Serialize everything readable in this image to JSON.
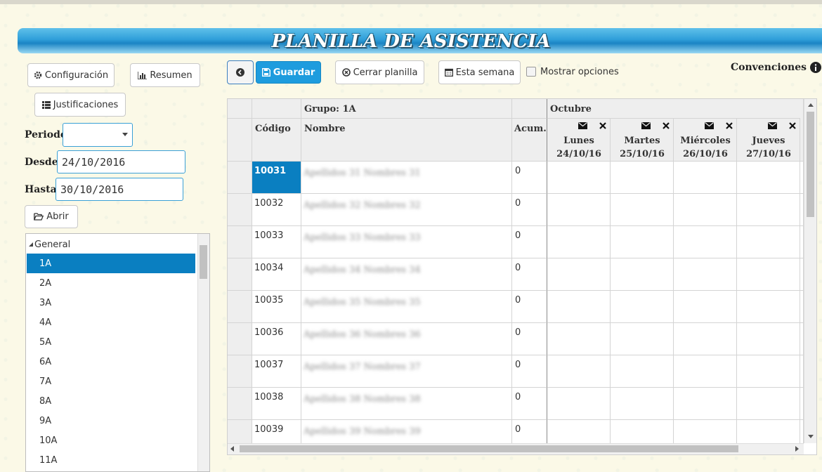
{
  "page": {
    "title": "PLANILLA DE ASISTENCIA"
  },
  "sidebar": {
    "config_label": "Configuración",
    "summary_label": "Resumen",
    "justifications_label": "Justificaciones",
    "period_label": "Periodo",
    "period_value": "",
    "from_label": "Desde",
    "from_value": "24/10/2016",
    "to_label": "Hasta",
    "to_value": "30/10/2016",
    "open_label": "Abrir",
    "tree": {
      "root": "General",
      "items": [
        "1A",
        "2A",
        "3A",
        "4A",
        "5A",
        "6A",
        "7A",
        "8A",
        "9A",
        "10A",
        "11A"
      ],
      "selected": "1A"
    }
  },
  "toolbar": {
    "save_label": "Guardar",
    "close_label": "Cerrar planilla",
    "week_label": "Esta semana",
    "options_label": "Mostrar opciones",
    "conventions_label": "Convenciones"
  },
  "grid": {
    "group_header": "Grupo: 1A",
    "month_header": "Octubre",
    "columns": {
      "code": "Código",
      "name": "Nombre",
      "acum": "Acum."
    },
    "days": [
      {
        "name": "Lunes",
        "date": "24/10/16"
      },
      {
        "name": "Martes",
        "date": "25/10/16"
      },
      {
        "name": "Miércoles",
        "date": "26/10/16"
      },
      {
        "name": "Jueves",
        "date": "27/10/16"
      }
    ],
    "rows": [
      {
        "code": "10031",
        "name": "Apellidos 31 Nombres 31",
        "acum": "0"
      },
      {
        "code": "10032",
        "name": "Apellidos 32 Nombres 32",
        "acum": "0"
      },
      {
        "code": "10033",
        "name": "Apellidos 33 Nombres 33",
        "acum": "0"
      },
      {
        "code": "10034",
        "name": "Apellidos 34 Nombres 34",
        "acum": "0"
      },
      {
        "code": "10035",
        "name": "Apellidos 35 Nombres 35",
        "acum": "0"
      },
      {
        "code": "10036",
        "name": "Apellidos 36 Nombres 36",
        "acum": "0"
      },
      {
        "code": "10037",
        "name": "Apellidos 37 Nombres 37",
        "acum": "0"
      },
      {
        "code": "10038",
        "name": "Apellidos 38 Nombres 38",
        "acum": "0"
      },
      {
        "code": "10039",
        "name": "Apellidos 39 Nombres 39",
        "acum": "0"
      }
    ],
    "selected_row": 0
  },
  "colors": {
    "accent": "#1e9cde",
    "selected": "#0a7fc1",
    "banner": "#2f9fd9"
  },
  "icons": [
    "gear-icon",
    "bar-chart-icon",
    "list-icon",
    "folder-open-icon",
    "back-circle-icon",
    "save-icon",
    "close-circle-icon",
    "calendar-icon",
    "info-icon",
    "envelope-icon",
    "x-icon",
    "caret-down-icon"
  ]
}
